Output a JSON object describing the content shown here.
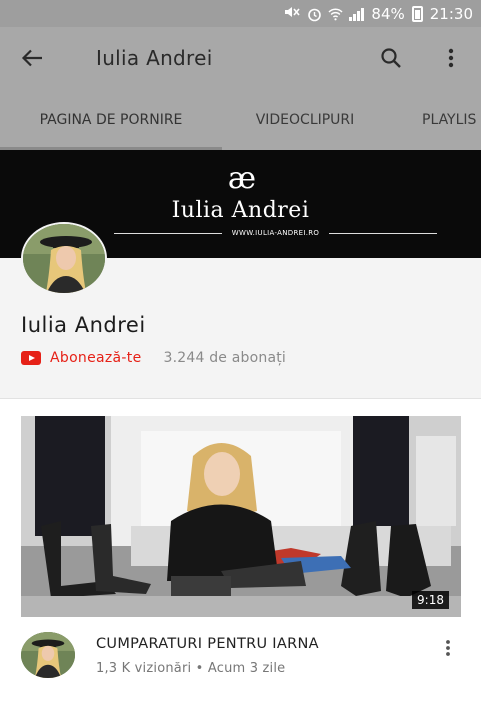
{
  "status_bar": {
    "battery": "84%",
    "time": "21:30"
  },
  "app_bar": {
    "title": "Iulia Andrei",
    "back_icon": "arrow-back-icon",
    "search_icon": "search-icon",
    "menu_icon": "more-vert-icon"
  },
  "tabs": [
    {
      "label": "PAGINA DE PORNIRE",
      "active": true
    },
    {
      "label": "VIDEOCLIPURI",
      "active": false
    },
    {
      "label": "PLAYLIS",
      "active": false
    }
  ],
  "banner": {
    "monogram": "æ",
    "name": "Iulia Andrei",
    "url": "WWW.IULIA-ANDREI.RO"
  },
  "channel": {
    "name": "Iulia Andrei",
    "subscribe_label": "Abonează-te",
    "subscriber_count": "3.244 de abonați"
  },
  "video": {
    "title": "CUMPARATURI PENTRU IARNA",
    "meta": "1,3 K vizionări • Acum 3 zile",
    "duration": "9:18"
  },
  "colors": {
    "app_bar": "#a8a8a8",
    "status_bar": "#9e9e9e",
    "accent_red": "#e62117"
  }
}
